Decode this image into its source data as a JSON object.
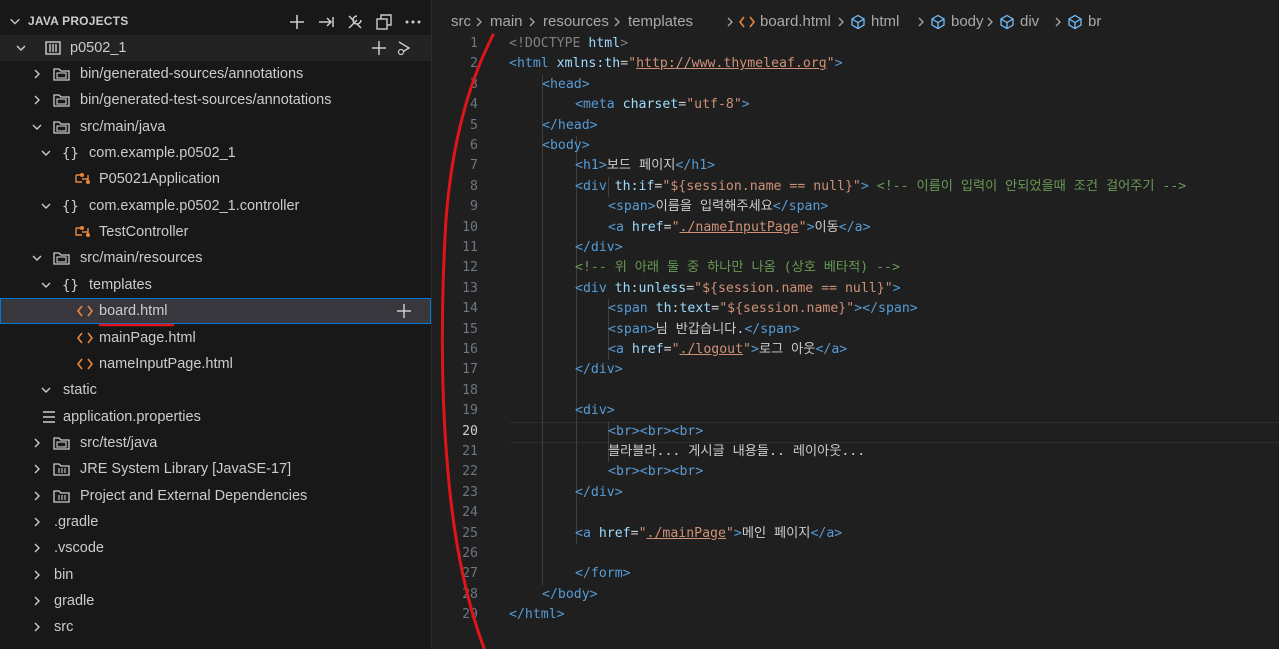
{
  "sidebar": {
    "title": "JAVA PROJECTS",
    "project": "p0502_1",
    "items": [
      {
        "label": "bin/generated-sources/annotations"
      },
      {
        "label": "bin/generated-test-sources/annotations"
      },
      {
        "label": "src/main/java"
      },
      {
        "label": "com.example.p0502_1"
      },
      {
        "label": "P05021Application"
      },
      {
        "label": "com.example.p0502_1.controller"
      },
      {
        "label": "TestController"
      },
      {
        "label": "src/main/resources"
      },
      {
        "label": "templates"
      },
      {
        "label": "board.html"
      },
      {
        "label": "mainPage.html"
      },
      {
        "label": "nameInputPage.html"
      },
      {
        "label": "static"
      },
      {
        "label": "application.properties"
      },
      {
        "label": "src/test/java"
      },
      {
        "label": "JRE System Library [JavaSE-17]"
      },
      {
        "label": "Project and External Dependencies"
      },
      {
        "label": ".gradle"
      },
      {
        "label": ".vscode"
      },
      {
        "label": "bin"
      },
      {
        "label": "gradle"
      },
      {
        "label": "src"
      }
    ]
  },
  "breadcrumb": [
    "src",
    "main",
    "resources",
    "templates",
    "board.html",
    "html",
    "body",
    "div",
    "br"
  ],
  "editor": {
    "current_line": 20,
    "line_numbers": [
      "1",
      "2",
      "3",
      "4",
      "5",
      "6",
      "7",
      "8",
      "9",
      "10",
      "11",
      "12",
      "13",
      "14",
      "15",
      "16",
      "17",
      "18",
      "19",
      "20",
      "21",
      "22",
      "23",
      "24",
      "25",
      "26",
      "27",
      "28",
      "29"
    ],
    "text": {
      "doctype": "<!DOCTYPE",
      "html_tag": "html",
      "html_open": "<html",
      "xmlns_attr": "xmlns:th",
      "xmlns_val": "http://www.thymeleaf.org",
      "head_open": "<head>",
      "meta_open": "<meta",
      "charset_attr": "charset",
      "charset_val": "\"utf-8\"",
      "head_close": "</head>",
      "body_open": "<body>",
      "h1_open": "<h1>",
      "h1_text": "보드 페이지",
      "h1_close": "</h1>",
      "div_open": "<div",
      "thif_attr": "th:if",
      "thif_val": "\"${session.name == null}\"",
      "comment1": "<!-- 이름이 입력이 안되었을때 조건 걸어주기 -->",
      "span_open": "<span>",
      "span_text1": "이름을 입력해주세요",
      "span_close": "</span>",
      "a_open": "<a",
      "href_attr": "href",
      "href1": "./nameInputPage",
      "a_text1": "이동",
      "a_close": "</a>",
      "div_close": "</div>",
      "comment2": "<!-- 위 아래 둘 중 하나만 나옴 (상호 베타적) -->",
      "thunless_attr": "th:unless",
      "thunless_val": "\"${session.name == null}\"",
      "span_open2": "<span",
      "thtext_attr": "th:text",
      "thtext_val": "\"${session.name}\"",
      "span_text2": "님 반갑습니다.",
      "href2": "./logout",
      "a_text2": "로그 아웃",
      "div_tag": "<div>",
      "br3": "<br><br><br>",
      "body_text": "블라블라... 게시글 내용들.. 레이아웃...",
      "href3": "./mainPage",
      "a_text3": "메인 페이지",
      "form_close": "</form>",
      "body_close": "</body>",
      "html_close": "</html>"
    }
  },
  "colors": {
    "tag": "#569cd6",
    "attr": "#9cdcfe",
    "string": "#ce9178",
    "comment": "#6a9955",
    "annotation_red": "#e0151a"
  }
}
